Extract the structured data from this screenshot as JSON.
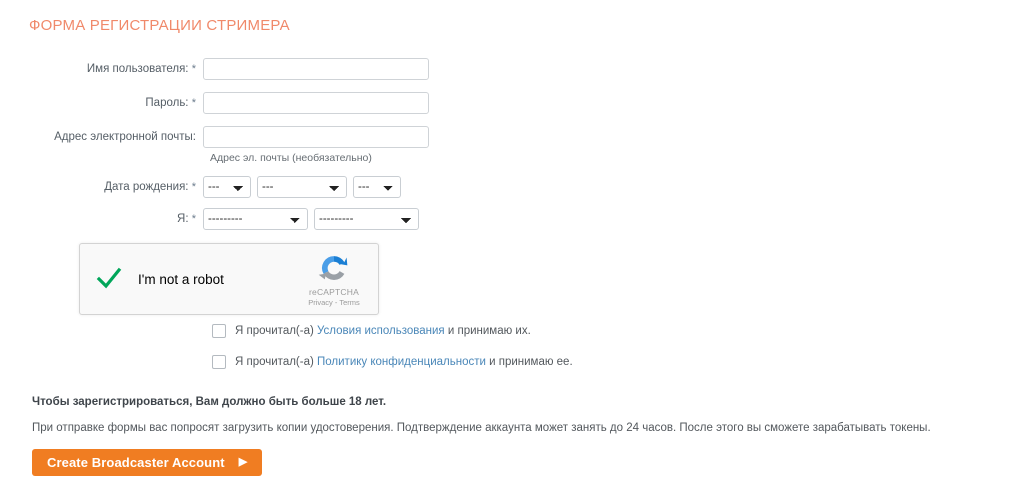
{
  "form": {
    "title": "ФОРМА РЕГИСТРАЦИИ СТРИМЕРА",
    "title_color": "#f0896a",
    "required_marker": "*",
    "fields": {
      "username": {
        "label": "Имя пользователя:",
        "required": true,
        "value": "",
        "placeholder": ""
      },
      "password": {
        "label": "Пароль:",
        "required": true,
        "value": "",
        "placeholder": ""
      },
      "email": {
        "label": "Адрес электронной почты:",
        "required": false,
        "value": "",
        "placeholder": "",
        "helper": "Адрес эл. почты (необязательно)"
      },
      "birthdate": {
        "label": "Дата рождения:",
        "required": true,
        "day": "---",
        "month": "---",
        "year": "---"
      },
      "iam": {
        "label": "Я:",
        "required": true,
        "gender": "---------",
        "seeking": "---------"
      }
    }
  },
  "recaptcha": {
    "label": "I'm not a robot",
    "checked": true,
    "check_color": "#00a65a",
    "brand": "reCAPTCHA",
    "privacy_label": "Privacy",
    "separator": "-",
    "terms_label": "Terms",
    "links_line": "Privacy - Terms"
  },
  "consents": [
    {
      "checked": false,
      "prefix": "Я прочитал(-а) ",
      "link": "Условия использования",
      "suffix": " и принимаю их."
    },
    {
      "checked": false,
      "prefix": "Я прочитал(-а) ",
      "link": "Политику конфиденциальности",
      "suffix": " и принимаю ее."
    }
  ],
  "notices": {
    "age_requirement": "Чтобы зарегистрироваться, Вам должно быть больше 18 лет.",
    "upload_info": "При отправке формы вас попросят загрузить копии удостоверения. Подтверждение аккаунта может занять до 24 часов. После этого вы сможете зарабатывать токены."
  },
  "submit": {
    "label": "Create Broadcaster Account",
    "arrow": "▶",
    "color": "#f07d22"
  },
  "link_color": "#4a87b8"
}
